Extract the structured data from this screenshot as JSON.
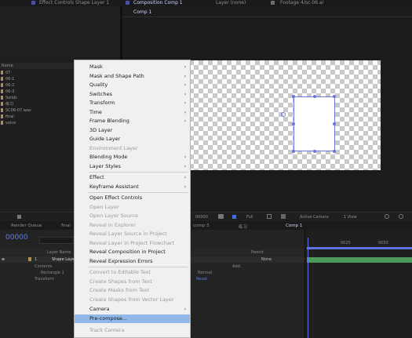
{
  "top_tabs": {
    "effect_controls": "Effect Controls Shape Layer 1",
    "composition": "Composition Comp 1",
    "layer": "Layer (none)",
    "footage": "Footage 4/sc-06.ai"
  },
  "comp_subtab": "Comp 1",
  "project": {
    "name_header": "Name",
    "items": [
      "07",
      "06-1",
      "06-2",
      "06-3",
      "Solids",
      "练习",
      "SC06-07.wav",
      "final",
      "voice"
    ]
  },
  "viewer_controls": {
    "timecode": "00000",
    "resolution": "Full",
    "camera": "Active Camera",
    "view": "1 View"
  },
  "bottom_tabs": {
    "render_queue": "Render Queue",
    "final": "final",
    "comp3": "comp 3",
    "lianxi": "练习",
    "comp1": "Comp 1"
  },
  "timeline": {
    "timecode": "00000",
    "layer_name_header": "Layer Name",
    "parent_header": "Parent",
    "layer_number": "1",
    "layer_name": "Shape Layer 1",
    "contents": "Contents",
    "add_label": "Add:",
    "rectangle": "Rectangle 1",
    "transform": "Transform",
    "parent_value": "None",
    "blend_mode": "Normal",
    "reset": "Reset",
    "ruler": [
      "0025",
      "0050"
    ]
  },
  "context_menu": {
    "items": [
      {
        "label": "Mask",
        "submenu": true,
        "disabled": false
      },
      {
        "label": "Mask and Shape Path",
        "submenu": true,
        "disabled": false
      },
      {
        "label": "Quality",
        "submenu": true,
        "disabled": false
      },
      {
        "label": "Switches",
        "submenu": true,
        "disabled": false
      },
      {
        "label": "Transform",
        "submenu": true,
        "disabled": false
      },
      {
        "label": "Time",
        "submenu": true,
        "disabled": false
      },
      {
        "label": "Frame Blending",
        "submenu": true,
        "disabled": false
      },
      {
        "label": "3D Layer",
        "submenu": false,
        "disabled": false
      },
      {
        "label": "Guide Layer",
        "submenu": false,
        "disabled": false
      },
      {
        "label": "Environment Layer",
        "submenu": false,
        "disabled": true
      },
      {
        "label": "Blending Mode",
        "submenu": true,
        "disabled": false
      },
      {
        "label": "Layer Styles",
        "submenu": true,
        "disabled": false
      },
      {
        "label": "Effect",
        "submenu": true,
        "disabled": false
      },
      {
        "label": "Keyframe Assistant",
        "submenu": true,
        "disabled": false
      },
      {
        "label": "Open Effect Controls",
        "submenu": false,
        "disabled": false
      },
      {
        "label": "Open Layer",
        "submenu": false,
        "disabled": true
      },
      {
        "label": "Open Layer Source",
        "submenu": false,
        "disabled": true
      },
      {
        "label": "Reveal in Explorer",
        "submenu": false,
        "disabled": true
      },
      {
        "label": "Reveal Layer Source in Project",
        "submenu": false,
        "disabled": true
      },
      {
        "label": "Reveal Layer in Project Flowchart",
        "submenu": false,
        "disabled": true
      },
      {
        "label": "Reveal Composition in Project",
        "submenu": false,
        "disabled": false
      },
      {
        "label": "Reveal Expression Errors",
        "submenu": false,
        "disabled": false
      },
      {
        "label": "Convert to Editable Text",
        "submenu": false,
        "disabled": true
      },
      {
        "label": "Create Shapes from Text",
        "submenu": false,
        "disabled": true
      },
      {
        "label": "Create Masks from Text",
        "submenu": false,
        "disabled": true
      },
      {
        "label": "Create Shapes from Vector Layer",
        "submenu": false,
        "disabled": true
      },
      {
        "label": "Camera",
        "submenu": true,
        "disabled": false
      },
      {
        "label": "Pre-compose...",
        "submenu": false,
        "disabled": false,
        "highlighted": true
      },
      {
        "label": "Track Camera",
        "submenu": false,
        "disabled": true
      }
    ]
  },
  "colors": {
    "menu_bg": "#f0f0f0",
    "menu_highlight": "#92b8e8",
    "accent_blue": "#5d74e0",
    "label_tan": "#ad8f52",
    "timeline_bar": "#4c9a5a"
  }
}
